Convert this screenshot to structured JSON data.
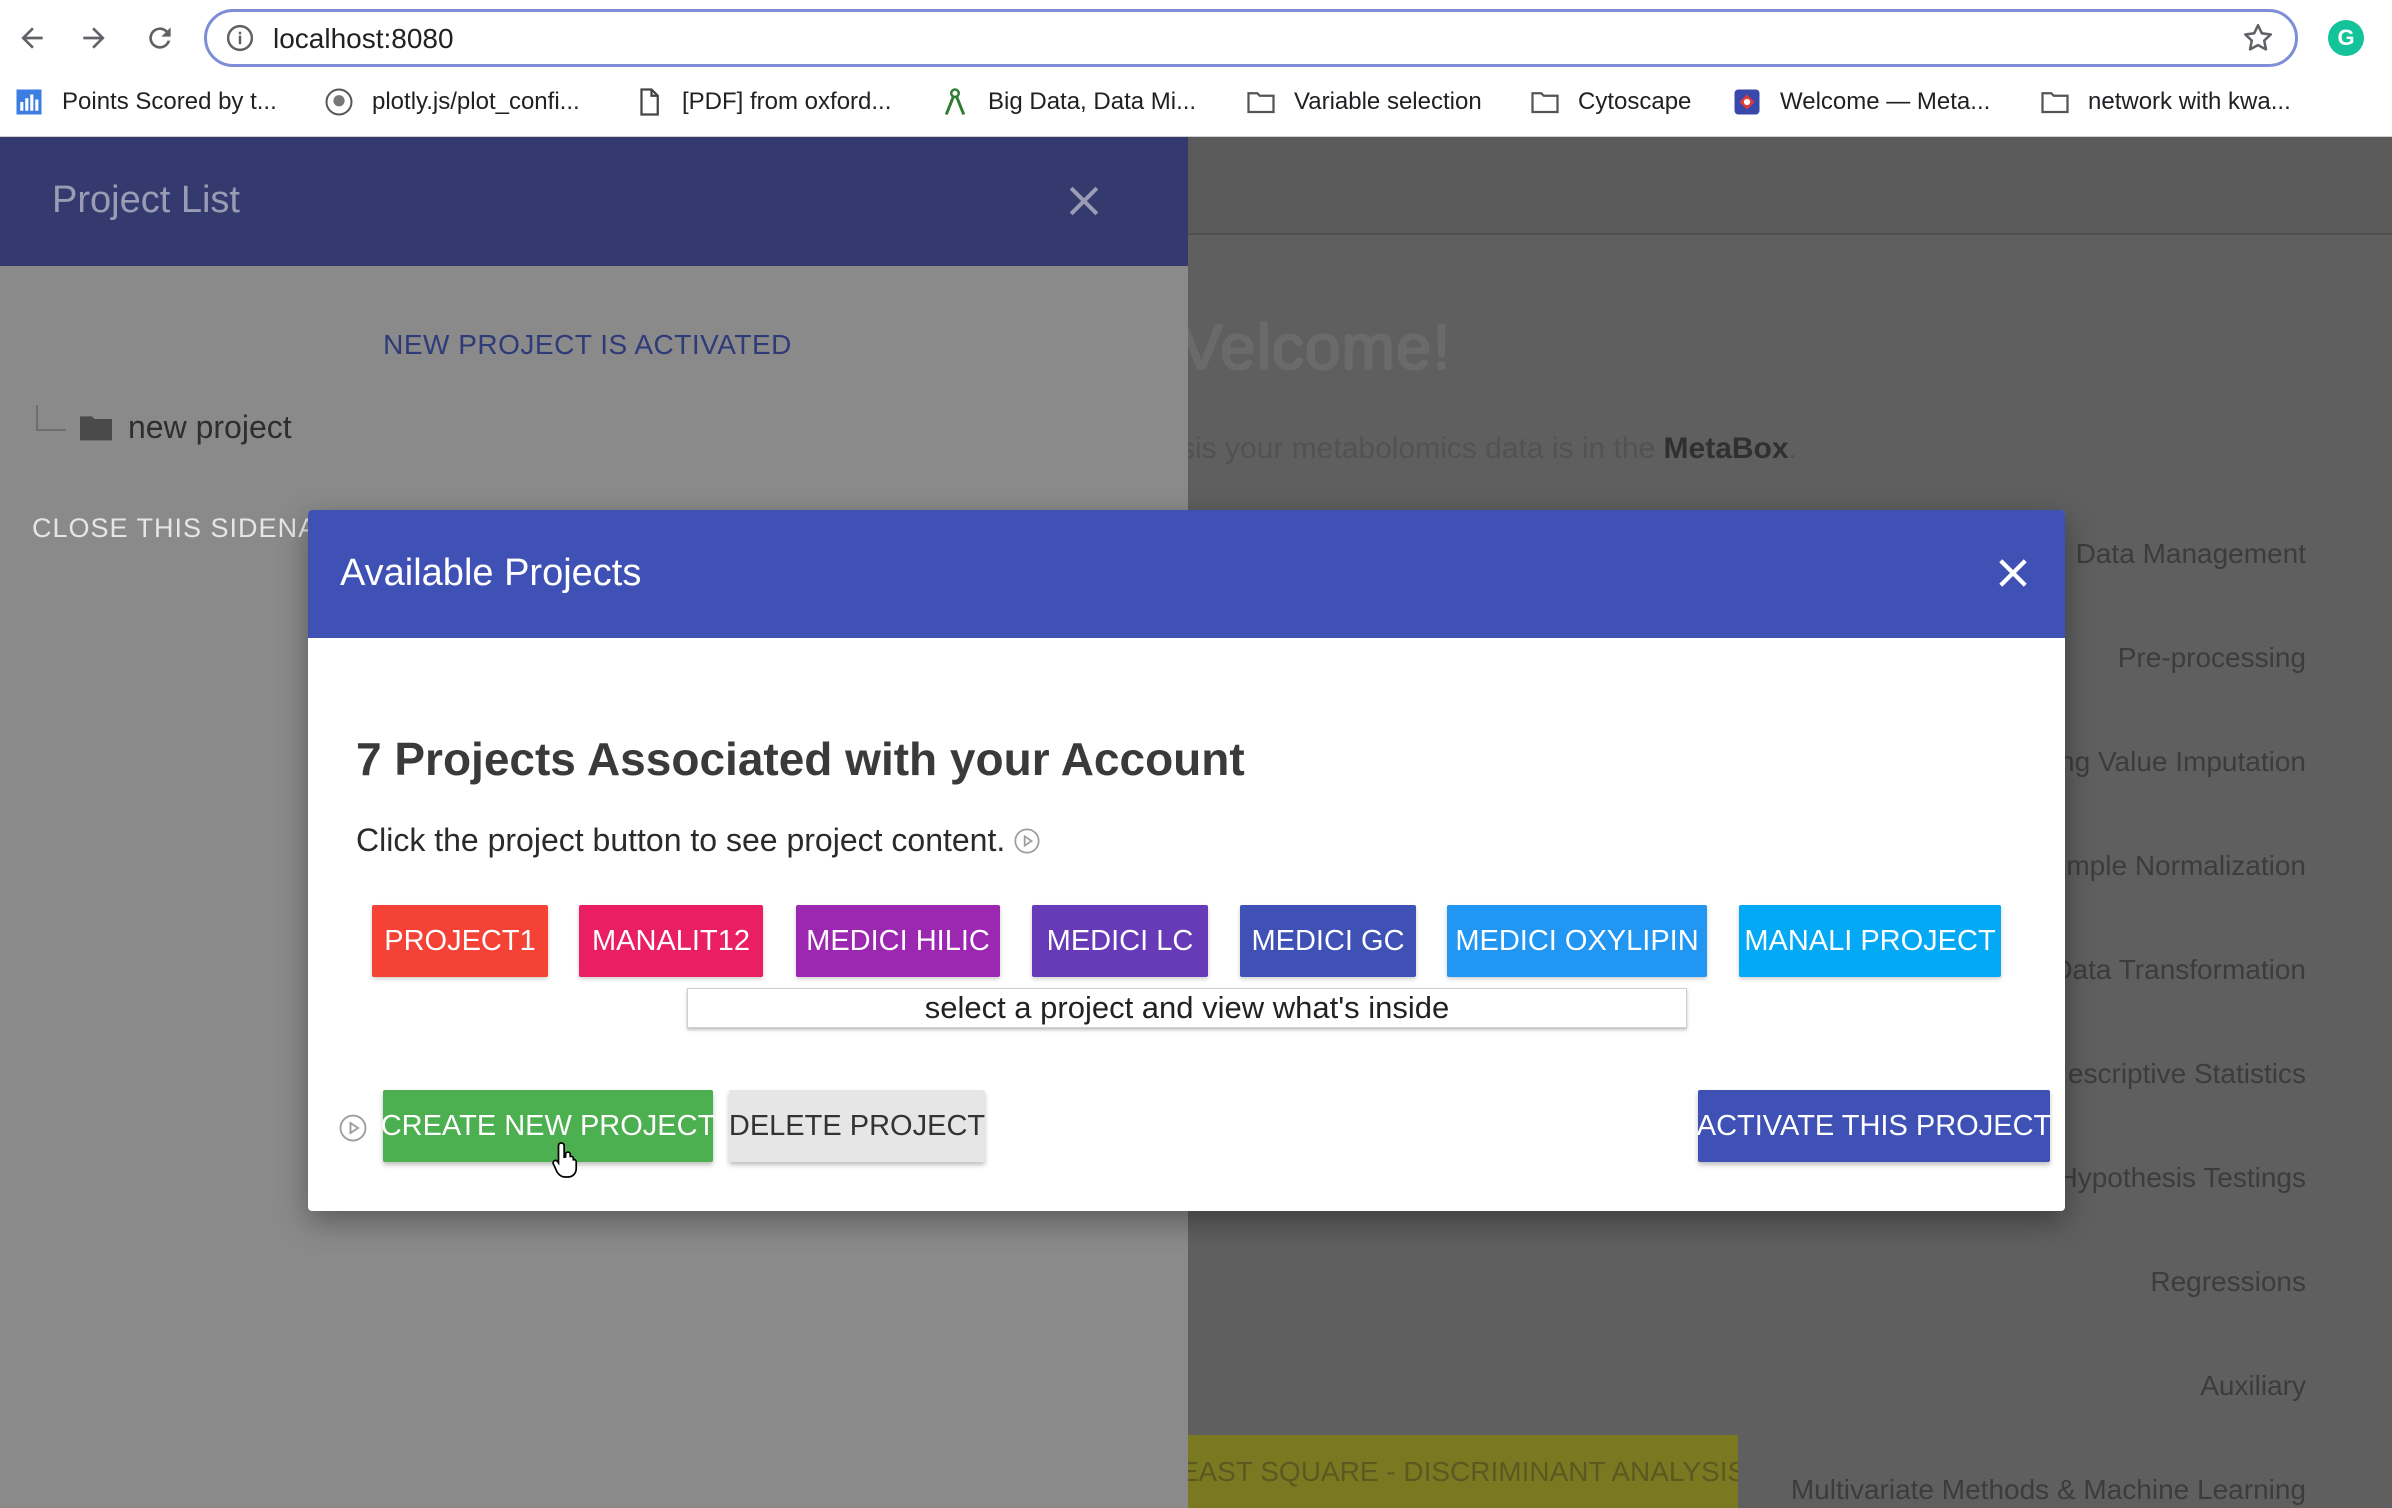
{
  "browser": {
    "url": "localhost:8080",
    "extension_letter": "G",
    "bookmarks": [
      {
        "label": "Points Scored by t...",
        "icon": "bar-chart-icon"
      },
      {
        "label": "plotly.js/plot_confi...",
        "icon": "github-icon"
      },
      {
        "label": "[PDF] from oxford...",
        "icon": "document-icon"
      },
      {
        "label": "Big Data, Data Mi...",
        "icon": "compass-icon"
      },
      {
        "label": "Variable selection",
        "icon": "folder-icon"
      },
      {
        "label": "Cytoscape",
        "icon": "folder-icon"
      },
      {
        "label": "Welcome — Meta...",
        "icon": "site-icon"
      },
      {
        "label": "network with kwa...",
        "icon": "folder-icon"
      }
    ]
  },
  "background": {
    "welcome": "Velcome!",
    "intro_text": "sis your metabolomics data is in the ",
    "intro_brand": "MetaBox",
    "intro_end": ".",
    "menu": [
      "Data Management",
      "Pre-processing",
      "ng Value Imputation",
      "mple Normalization",
      "Data Transformation",
      "escriptive Statistics",
      "Hypothesis Testings",
      "Regressions",
      "Auxiliary",
      "Multivariate Methods & Machine Learning"
    ],
    "pls_bar": "EAST SQUARE - DISCRIMINANT ANALYSIS"
  },
  "sidenav": {
    "title": "Project List",
    "activated_message": "NEW PROJECT IS ACTIVATED",
    "tree_item": "new project",
    "close_link": "CLOSE THIS SIDENAV"
  },
  "modal": {
    "title": "Available Projects",
    "heading": "7 Projects Associated with your Account",
    "subtext": "Click the project button to see project content.",
    "projects": [
      {
        "label": "PROJECT1",
        "color": "#f44336"
      },
      {
        "label": "MANALIT12",
        "color": "#e91e63"
      },
      {
        "label": "MEDICI HILIC",
        "color": "#9c27b0"
      },
      {
        "label": "MEDICI LC",
        "color": "#673ab7"
      },
      {
        "label": "MEDICI GC",
        "color": "#3f51b5"
      },
      {
        "label": "MEDICI OXYLIPIN",
        "color": "#2196f3"
      },
      {
        "label": "MANALI PROJECT",
        "color": "#03a9f4"
      }
    ],
    "tooltip": "select a project and view what's inside",
    "create_button": "CREATE NEW PROJECT",
    "delete_button": "DELETE PROJECT",
    "activate_button": "ACTIVATE THIS PROJECT"
  }
}
